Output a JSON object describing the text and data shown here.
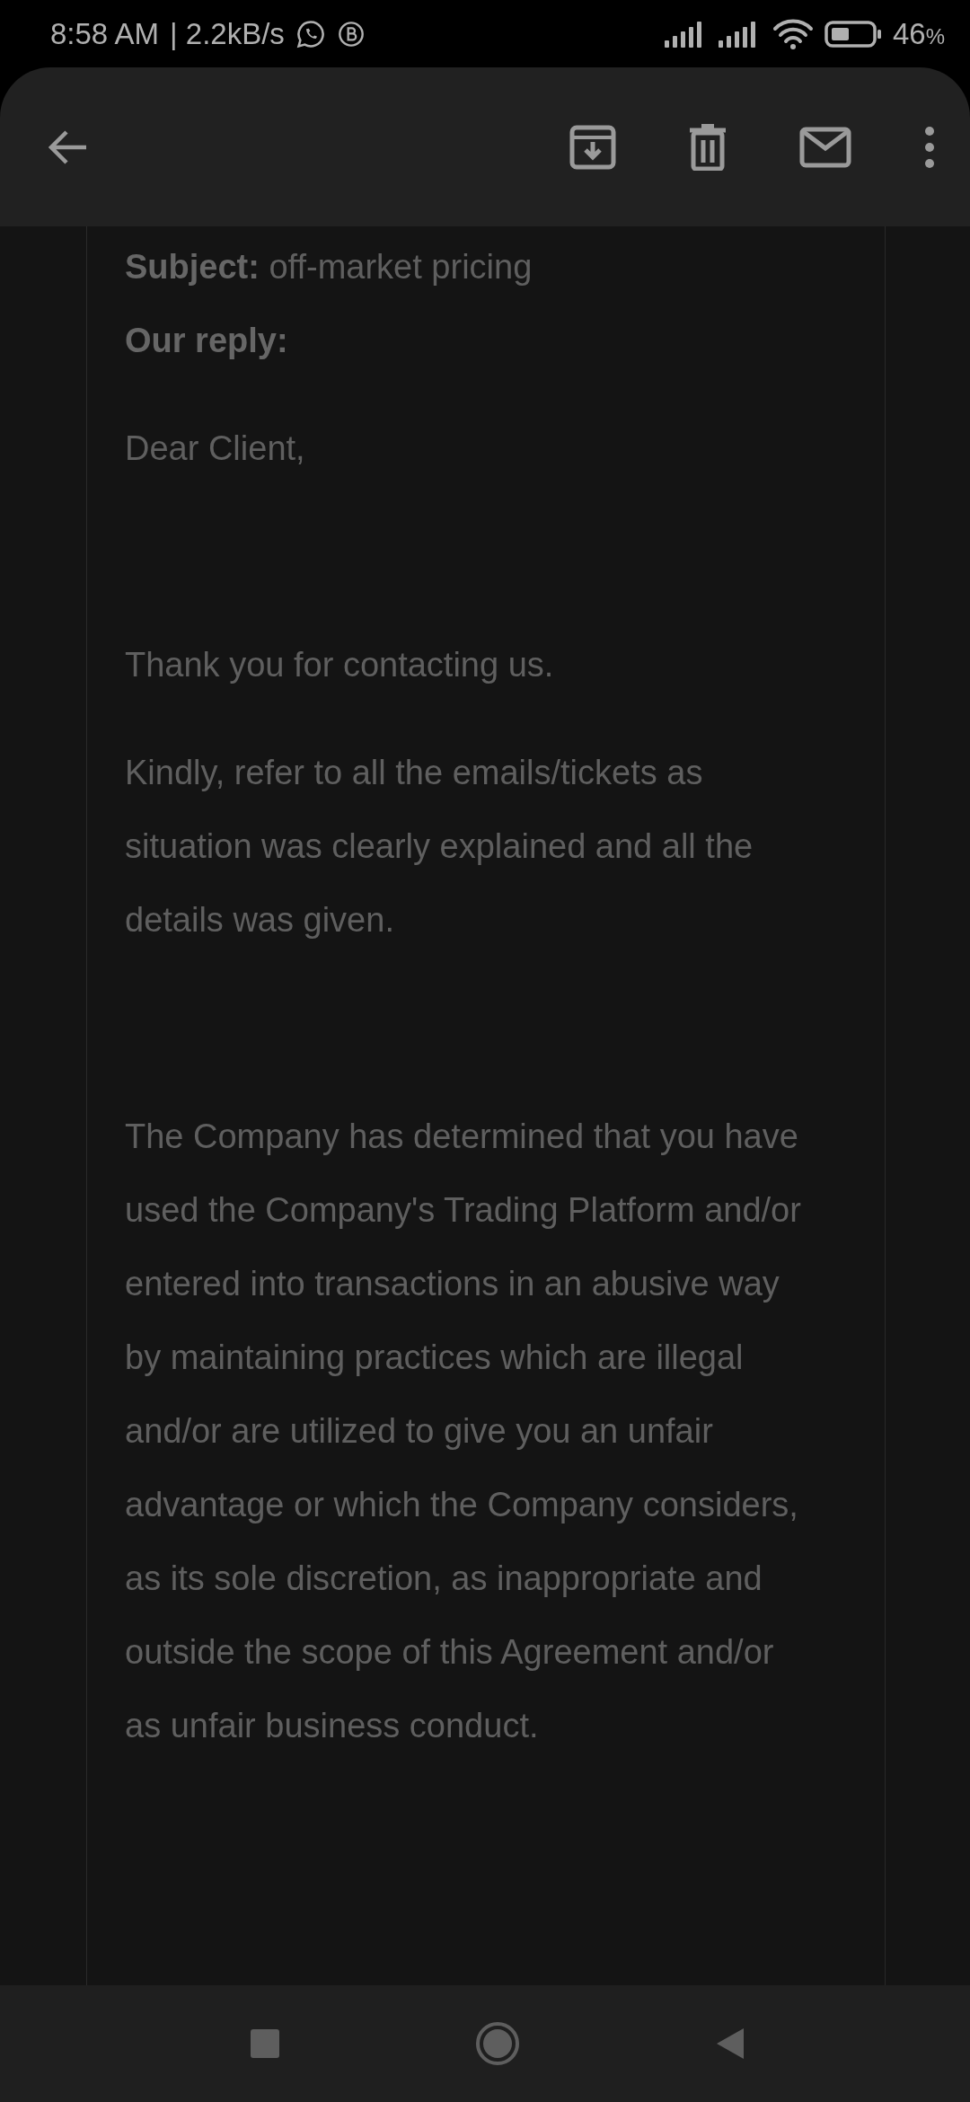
{
  "status_bar": {
    "time": "8:58 AM",
    "speed": "| 2.2kB/s",
    "battery": "46",
    "battery_unit": "%"
  },
  "message": {
    "subject_label": "Subject:",
    "subject": "off-market pricing",
    "reply_label": "Our reply:",
    "paragraphs": [
      {
        "text": "Dear Client,"
      },
      {
        "text": "Thank you for contacting us."
      },
      {
        "text": "Kindly, refer to all the emails/tickets as situation was clearly explained and all the details was given."
      },
      {
        "text": "The Company has determined that you have used the Company's Trading Platform and/or entered into transactions in an abusive way by maintaining practices which are illegal and/or are utilized to give you an unfair advantage or which the Company considers, as its sole discretion, as inappropriate and outside the scope of this Agreement and/or as unfair business conduct."
      }
    ]
  }
}
